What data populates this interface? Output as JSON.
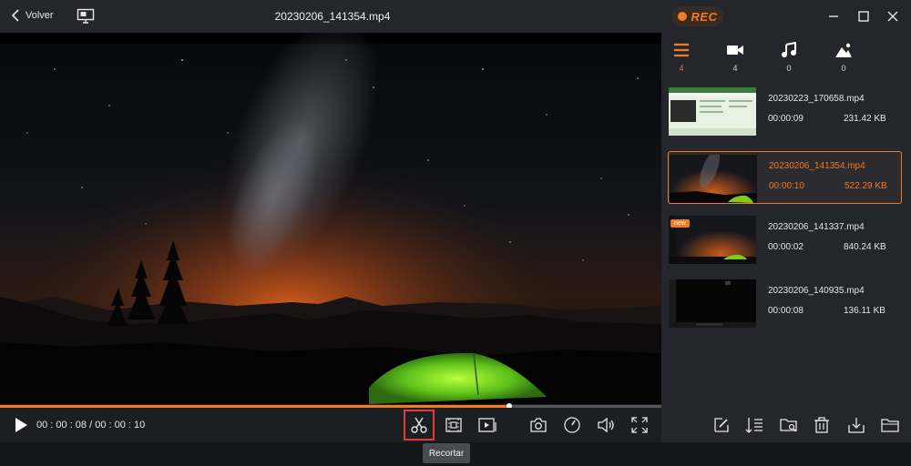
{
  "header": {
    "back_label": "Volver",
    "file_title": "20230206_141354.mp4",
    "rec_label": "REC"
  },
  "player": {
    "timecode": "00 : 00 : 08 / 00 : 00 : 10",
    "progress_fraction": 0.77,
    "tooltip": "Recortar"
  },
  "tabs": [
    {
      "icon": "list-icon",
      "count": "4"
    },
    {
      "icon": "video-camera-icon",
      "count": "4"
    },
    {
      "icon": "music-note-icon",
      "count": "0"
    },
    {
      "icon": "image-icon",
      "count": "0"
    }
  ],
  "recordings": [
    {
      "name": "20230223_170658.mp4",
      "duration": "00:00:09",
      "size": "231.42 KB"
    },
    {
      "name": "20230206_141354.mp4",
      "duration": "00:00:10",
      "size": "522.29 KB"
    },
    {
      "name": "20230206_141337.mp4",
      "duration": "00:00:02",
      "size": "840.24 KB",
      "badge": "new"
    },
    {
      "name": "20230206_140935.mp4",
      "duration": "00:00:08",
      "size": "136.11 KB"
    }
  ],
  "colors": {
    "accent": "#f47a21",
    "highlight": "#e23b3b"
  }
}
